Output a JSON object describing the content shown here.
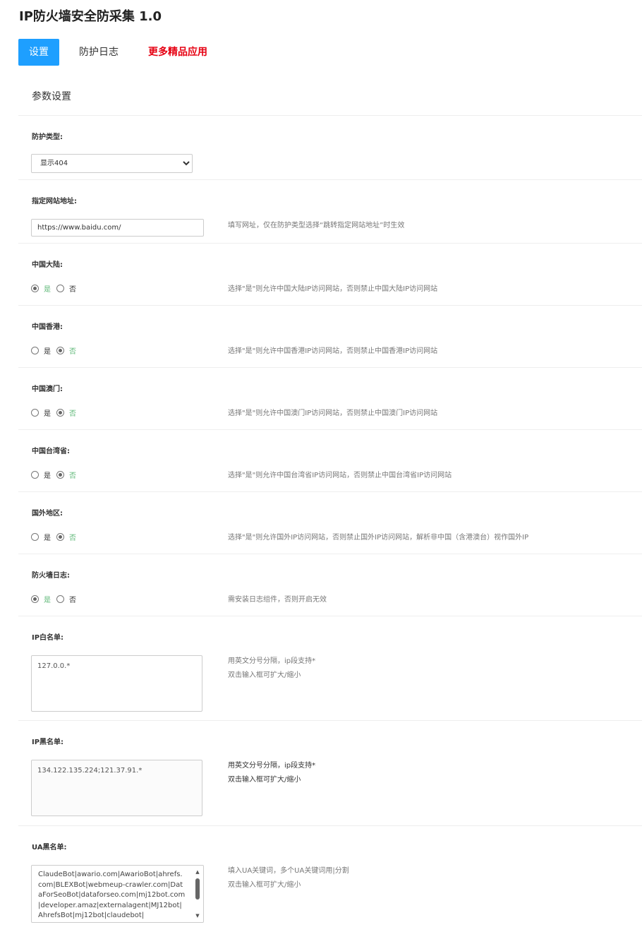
{
  "app": {
    "title": "IP防火墙安全防采集 1.0"
  },
  "tabs": [
    {
      "label": "设置"
    },
    {
      "label": "防护日志"
    },
    {
      "label": "更多精品应用"
    }
  ],
  "panel": {
    "title": "参数设置"
  },
  "settings": {
    "protect_type": {
      "label": "防护类型:",
      "value": "显示404"
    },
    "site_url": {
      "label": "指定网站地址:",
      "value": "https://www.baidu.com/",
      "tip": "填写网址，仅在防护类型选择“跳转指定网站地址”时生效"
    },
    "mainland": {
      "label": "中国大陆:",
      "yes": "是",
      "no": "否",
      "selected": "yes",
      "tip": "选择\"是\"则允许中国大陆IP访问网站，否则禁止中国大陆IP访问网站"
    },
    "hongkong": {
      "label": "中国香港:",
      "yes": "是",
      "no": "否",
      "selected": "no",
      "tip": "选择\"是\"则允许中国香港IP访问网站，否则禁止中国香港IP访问网站"
    },
    "macau": {
      "label": "中国澳门:",
      "yes": "是",
      "no": "否",
      "selected": "no",
      "tip": "选择\"是\"则允许中国澳门IP访问网站，否则禁止中国澳门IP访问网站"
    },
    "taiwan": {
      "label": "中国台湾省:",
      "yes": "是",
      "no": "否",
      "selected": "no",
      "tip": "选择\"是\"则允许中国台湾省IP访问网站，否则禁止中国台湾省IP访问网站"
    },
    "foreign": {
      "label": "国外地区:",
      "yes": "是",
      "no": "否",
      "selected": "no",
      "tip": "选择\"是\"则允许国外IP访问网站，否则禁止国外IP访问网站，解析非中国（含港澳台）视作国外IP"
    },
    "firewall_log": {
      "label": "防火墙日志:",
      "yes": "是",
      "no": "否",
      "selected": "yes",
      "tip": "需安装日志组件，否则开启无效"
    },
    "ip_whitelist": {
      "label": "IP白名单:",
      "value": "127.0.0.*",
      "tip1": "用英文分号分隔，ip段支持*",
      "tip2": "双击输入框可扩大/缩小"
    },
    "ip_blacklist": {
      "label": "IP黑名单:",
      "value": "134.122.135.224;121.37.91.*",
      "tip1": "用英文分号分隔，ip段支持*",
      "tip2": "双击输入框可扩大/缩小"
    },
    "ua_blacklist": {
      "label": "UA黑名单:",
      "value": "ClaudeBot|awario.com|AwarioBot|ahrefs.com|BLEXBot|webmeup-crawler.com|DataForSeoBot|dataforseo.com|mj12bot.com|developer.amaz|externalagent|MJ12bot|AhrefsBot|mj12bot|claudebot|",
      "tip1": "填入UA关键词，多个UA关键词用|分割",
      "tip2": "双击输入框可扩大/缩小"
    }
  },
  "icons": {
    "select_arrow": "chevron-down-icon",
    "scroll_up": "scroll-up-arrow-icon",
    "scroll_down": "scroll-down-arrow-icon"
  },
  "colors": {
    "tab_active": "#1e9fff",
    "promo": "#e60012",
    "radio_selected_text": "#5fb878"
  }
}
